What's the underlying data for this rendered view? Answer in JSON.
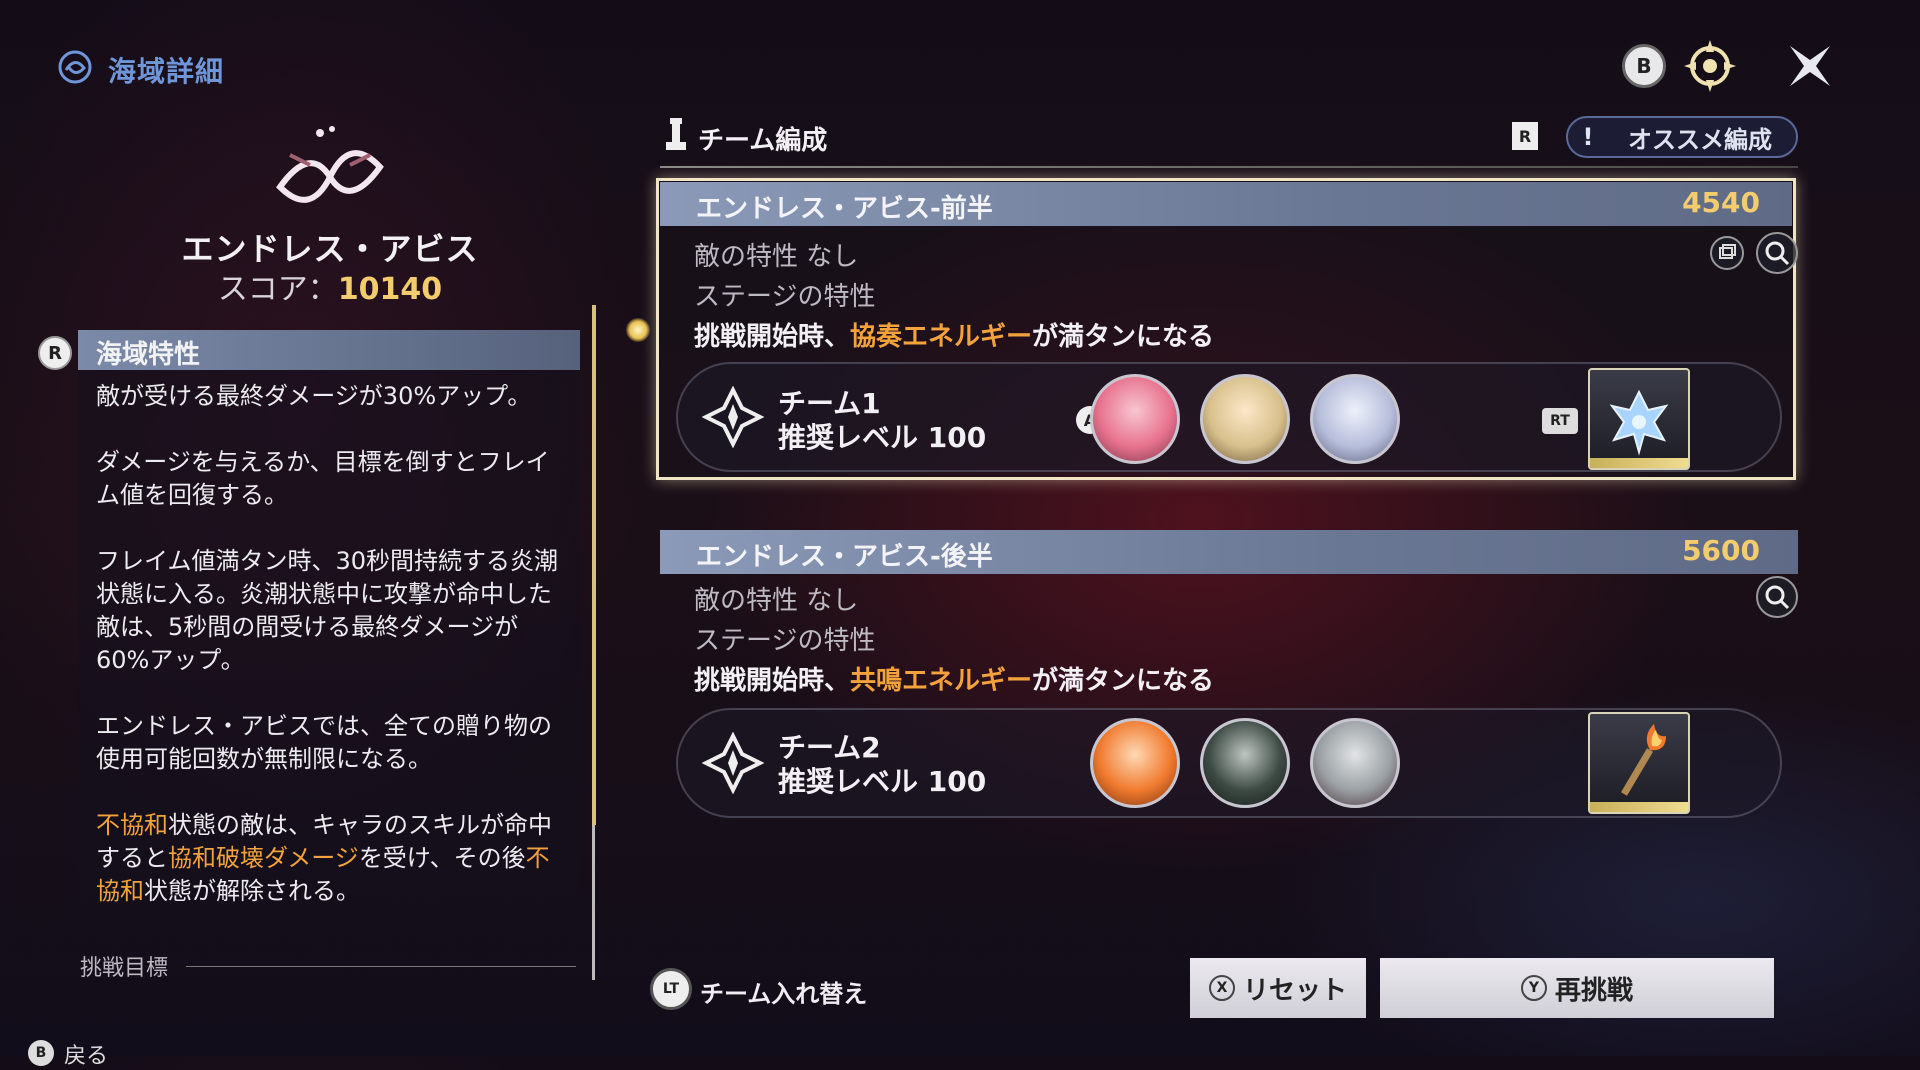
{
  "header": {
    "title": "海域詳細",
    "b_button": "B"
  },
  "stage": {
    "name": "エンドレス・アビス",
    "score_label": "スコア：",
    "score_value": "10140"
  },
  "sea_traits": {
    "button": "R",
    "title": "海域特性",
    "paragraphs": [
      "敵が受ける最終ダメージが30%アップ。",
      "ダメージを与えるか、目標を倒すとフレイム値を回復する。",
      "フレイム値満タン時、30秒間持続する炎潮状態に入る。炎潮状態中に攻撃が命中した敵は、5秒間の間受ける最終ダメージが60%アップ。",
      "エンドレス・アビスでは、全ての贈り物の使用可能回数が無制限になる。"
    ],
    "last_paragraph": {
      "p1": "不協和",
      "p2": "状態の敵は、キャラのスキルが命中すると",
      "p3": "協和破壊ダメージ",
      "p4": "を受け、その後",
      "p5": "不協和",
      "p6": "状態が解除される。"
    }
  },
  "challenge_goal": "挑戦目標",
  "back": {
    "button": "B",
    "label": "戻る"
  },
  "team_panel": {
    "title": "チーム編成",
    "r_button": "R",
    "recommend_mark": "!",
    "recommend_label": "オススメ編成"
  },
  "stages": [
    {
      "title": "エンドレス・アビス-前半",
      "score": "4540",
      "enemy_trait": "敵の特性  なし",
      "stage_trait_label": "ステージの特性",
      "stage_trait_prefix": "挑戦開始時、",
      "stage_trait_highlight": "協奏エネルギー",
      "stage_trait_suffix": "が満タンになる",
      "team_name": "チーム1",
      "recommended_level": "推奨レベル 100",
      "a_button": "A",
      "rt_button": "RT",
      "avatars": [
        "pink-hair-character",
        "blonde-character",
        "silver-hair-character"
      ],
      "item": "blue-crystal-flower"
    },
    {
      "title": "エンドレス・アビス-後半",
      "score": "5600",
      "enemy_trait": "敵の特性  なし",
      "stage_trait_label": "ステージの特性",
      "stage_trait_prefix": "挑戦開始時、",
      "stage_trait_highlight": "共鳴エネルギー",
      "stage_trait_suffix": "が満タンになる",
      "team_name": "チーム2",
      "recommended_level": "推奨レベル 100",
      "avatars": [
        "orange-hair-character",
        "dark-hair-character",
        "gray-hair-character"
      ],
      "item": "flaming-torch"
    }
  ],
  "bottom": {
    "lt_button": "LT",
    "swap_label": "チーム入れ替え",
    "reset_button_glyph": "X",
    "reset_label": "リセット",
    "retry_button_glyph": "Y",
    "retry_label": "再挑戦"
  },
  "colors": {
    "highlight": "#f4a23c",
    "score_gold": "#f3cc6e",
    "title_blue": "#6f96d8"
  }
}
